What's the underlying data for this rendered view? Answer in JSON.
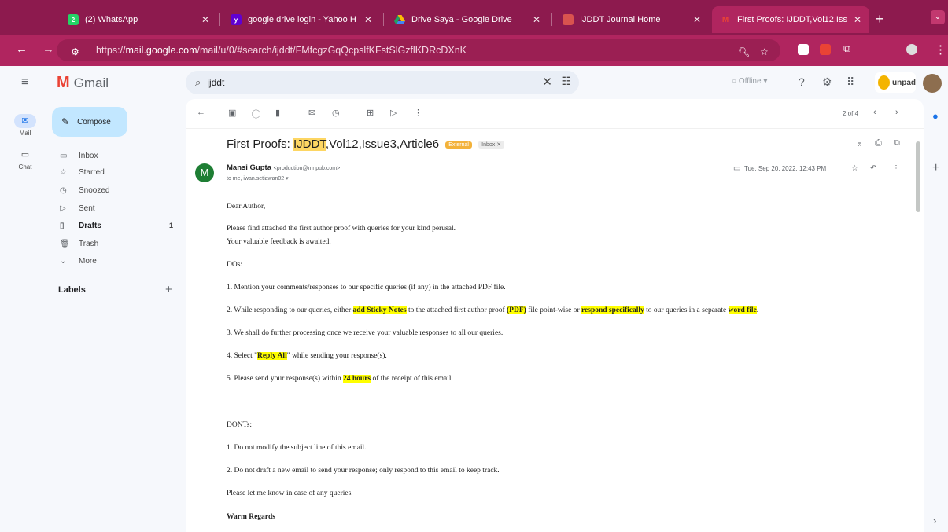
{
  "browser": {
    "tabs": [
      {
        "title": "(2) WhatsApp",
        "color": "#25d366"
      },
      {
        "title": "google drive login - Yahoo H",
        "color": "#6001d2"
      },
      {
        "title": "Drive Saya - Google Drive",
        "color": "#fbbc04"
      },
      {
        "title": "IJDDT Journal Home",
        "color": "#d9534f"
      },
      {
        "title": "First Proofs: IJDDT,Vol12,Iss",
        "color": "#ea4335"
      }
    ],
    "url_prefix": "https://",
    "url_host": "mail.google.com",
    "url_path": "/mail/u/0/#search/ijddt/FMfcgzGqQcpslfKFstSlGzflKDRcDXnK"
  },
  "gmail": {
    "logo_text": "Gmail",
    "search_query": "ijddt",
    "offline_label": "Offline",
    "unpad_label": "unpad",
    "rail": [
      {
        "label": "Mail",
        "icon": "mail-icon"
      },
      {
        "label": "Chat",
        "icon": "chat-icon"
      }
    ],
    "compose_label": "Compose",
    "nav": [
      {
        "label": "Inbox",
        "icon": "inbox-icon",
        "count": ""
      },
      {
        "label": "Starred",
        "icon": "star-icon",
        "count": ""
      },
      {
        "label": "Snoozed",
        "icon": "clock-icon",
        "count": ""
      },
      {
        "label": "Sent",
        "icon": "send-icon",
        "count": ""
      },
      {
        "label": "Drafts",
        "icon": "draft-icon",
        "count": "1"
      },
      {
        "label": "Trash",
        "icon": "trash-icon",
        "count": ""
      },
      {
        "label": "More",
        "icon": "chevron-down-icon",
        "count": ""
      }
    ],
    "labels_heading": "Labels"
  },
  "email": {
    "page_count": "2 of 4",
    "subject_before": "First Proofs: ",
    "subject_highlight": "IJDDT",
    "subject_after": ",Vol12,Issue3,Article6",
    "badge_external": "External",
    "badge_inbox": "Inbox",
    "sender_initial": "M",
    "sender_name": "Mansi Gupta",
    "sender_email": "<production@mripub.com>",
    "to_line": "to me, iwan.setiawan02",
    "date": "Tue, Sep 20, 2022, 12:43 PM",
    "greeting": "Dear Author,",
    "p1": "Please find attached the first author proof with queries for your kind perusal.",
    "p2": "Your valuable feedback is awaited.",
    "dos": "DOs:",
    "item1_a": "1. Mention your comments/responses to our specific queries (if any) in the attached PDF file.",
    "item2_a": "2. While responding to our queries, either ",
    "item2_b": "add Sticky Notes",
    "item2_c": " to the attached first author proof ",
    "item2_d": "(PDF)",
    "item2_e": " file point-wise or ",
    "item2_f": "respond specifically",
    "item2_g": " to our queries in a separate ",
    "item2_h": "word file",
    "item2_i": ".",
    "item3": "3. We shall do further processing once we receive your valuable responses to all our queries.",
    "item4_a": "4. Select \"",
    "item4_b": "Reply All",
    "item4_c": "\" while sending your response(s).",
    "item5_a": "5. Please send your response(s) within ",
    "item5_b": "24 hours",
    "item5_c": " of the receipt of this email.",
    "donts": "DONTs:",
    "dont1": "1. Do not modify the subject line of this email.",
    "dont2": "2. Do not draft a new email to send your response; only respond to this email to keep track.",
    "closing_q": "Please let me know in case of any queries.",
    "regards": "Warm Regards"
  }
}
